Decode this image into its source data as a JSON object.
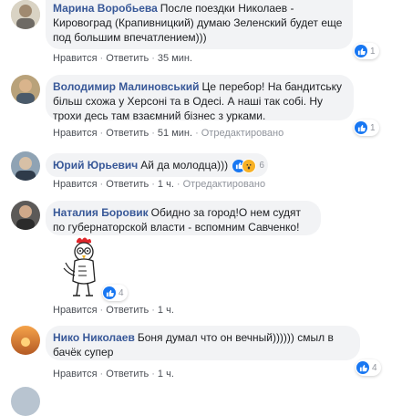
{
  "comments": [
    {
      "author": "Марина Воробьева",
      "text": "После поездки Николаев - Кировоград (Крапивницкий) думаю Зеленский будет еще под большим впечатлением)))",
      "like": "Нравится",
      "reply": "Ответить",
      "time": "35 мин.",
      "reactions": "1",
      "edited": ""
    },
    {
      "author": "Володимир Малиновський",
      "text": "Це перебор! На бандитську більш схожа у Херсоні та в Одесі. А наші так собі. Ну трохи десь там взаємний бізнес з урками.",
      "like": "Нравится",
      "reply": "Ответить",
      "time": "51 мин.",
      "reactions": "1",
      "edited": "Отредактировано"
    },
    {
      "author": "Юрий Юрьевич",
      "text": "Ай да молодца)))",
      "like": "Нравится",
      "reply": "Ответить",
      "time": "1 ч.",
      "reactions": "6",
      "edited": "Отредактировано"
    },
    {
      "author": "Наталия Боровик",
      "text": "Обидно за город!О нем судят по губернаторской власти - вспомним Савченко!",
      "like": "Нравится",
      "reply": "Ответить",
      "time": "1 ч.",
      "reactions": "4",
      "edited": ""
    },
    {
      "author": "Нико Николаев",
      "text": "Боня думал что он вечный)))))) смыл в бачёк супер",
      "like": "Нравится",
      "reply": "Ответить",
      "time": "1 ч.",
      "reactions": "4",
      "edited": ""
    }
  ],
  "colors": {
    "author": "#385898",
    "bubble": "#f2f3f5",
    "like": "#1877f2",
    "meta": "#90949c"
  }
}
